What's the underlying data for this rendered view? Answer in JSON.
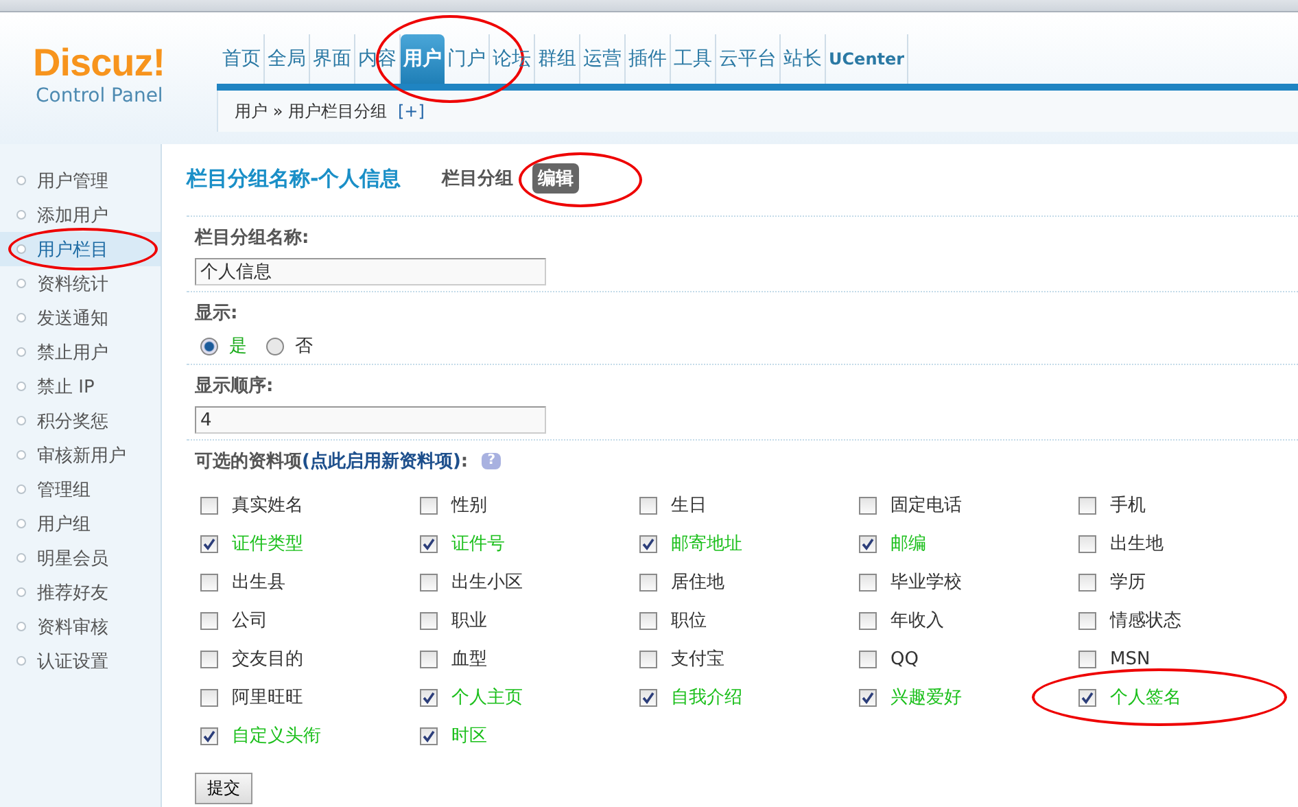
{
  "logo": {
    "title": "Discuz!",
    "subtitle": "Control Panel"
  },
  "nav": [
    {
      "label": "首页",
      "selected": false,
      "circled": false
    },
    {
      "label": "全局",
      "selected": false,
      "circled": false
    },
    {
      "label": "界面",
      "selected": false,
      "circled": false
    },
    {
      "label": "内容",
      "selected": false,
      "circled": false
    },
    {
      "label": "用户",
      "selected": true,
      "circled": true
    },
    {
      "label": "门户",
      "selected": false,
      "circled": false
    },
    {
      "label": "论坛",
      "selected": false,
      "circled": false
    },
    {
      "label": "群组",
      "selected": false,
      "circled": false
    },
    {
      "label": "运营",
      "selected": false,
      "circled": false
    },
    {
      "label": "插件",
      "selected": false,
      "circled": false
    },
    {
      "label": "工具",
      "selected": false,
      "circled": false
    },
    {
      "label": "云平台",
      "selected": false,
      "circled": false
    },
    {
      "label": "站长",
      "selected": false,
      "circled": false
    },
    {
      "label": "UCenter",
      "selected": false,
      "circled": false
    }
  ],
  "breadcrumb": {
    "path": "用户 » 用户栏目分组",
    "add": "[+]"
  },
  "sidebar": [
    {
      "label": "用户管理",
      "selected": false,
      "circled": false
    },
    {
      "label": "添加用户",
      "selected": false,
      "circled": false
    },
    {
      "label": "用户栏目",
      "selected": true,
      "circled": true
    },
    {
      "label": "资料统计",
      "selected": false,
      "circled": false
    },
    {
      "label": "发送通知",
      "selected": false,
      "circled": false
    },
    {
      "label": "禁止用户",
      "selected": false,
      "circled": false
    },
    {
      "label": "禁止 IP",
      "selected": false,
      "circled": false
    },
    {
      "label": "积分奖惩",
      "selected": false,
      "circled": false
    },
    {
      "label": "审核新用户",
      "selected": false,
      "circled": false
    },
    {
      "label": "管理组",
      "selected": false,
      "circled": false
    },
    {
      "label": "用户组",
      "selected": false,
      "circled": false
    },
    {
      "label": "明星会员",
      "selected": false,
      "circled": false
    },
    {
      "label": "推荐好友",
      "selected": false,
      "circled": false
    },
    {
      "label": "资料审核",
      "selected": false,
      "circled": false
    },
    {
      "label": "认证设置",
      "selected": false,
      "circled": false
    }
  ],
  "page_title": "栏目分组名称-个人信息",
  "tabs": [
    {
      "label": "栏目分组",
      "selected": false,
      "circled": false
    },
    {
      "label": "编辑",
      "selected": true,
      "circled": true
    }
  ],
  "form": {
    "name_label": "栏目分组名称:",
    "name_value": "个人信息",
    "display_label": "显示:",
    "display_options": [
      {
        "label": "是",
        "selected": true
      },
      {
        "label": "否",
        "selected": false
      }
    ],
    "order_label": "显示顺序:",
    "order_value": "4",
    "fields_label": "可选的资料项",
    "fields_link": "(点此启用新资料项)",
    "fields_label_end": ":",
    "help_icon": "?",
    "options": [
      {
        "label": "真实姓名",
        "checked": false,
        "circled": false
      },
      {
        "label": "性别",
        "checked": false,
        "circled": false
      },
      {
        "label": "生日",
        "checked": false,
        "circled": false
      },
      {
        "label": "固定电话",
        "checked": false,
        "circled": false
      },
      {
        "label": "手机",
        "checked": false,
        "circled": false
      },
      {
        "label": "证件类型",
        "checked": true,
        "circled": false
      },
      {
        "label": "证件号",
        "checked": true,
        "circled": false
      },
      {
        "label": "邮寄地址",
        "checked": true,
        "circled": false
      },
      {
        "label": "邮编",
        "checked": true,
        "circled": false
      },
      {
        "label": "出生地",
        "checked": false,
        "circled": false
      },
      {
        "label": "出生县",
        "checked": false,
        "circled": false
      },
      {
        "label": "出生小区",
        "checked": false,
        "circled": false
      },
      {
        "label": "居住地",
        "checked": false,
        "circled": false
      },
      {
        "label": "毕业学校",
        "checked": false,
        "circled": false
      },
      {
        "label": "学历",
        "checked": false,
        "circled": false
      },
      {
        "label": "公司",
        "checked": false,
        "circled": false
      },
      {
        "label": "职业",
        "checked": false,
        "circled": false
      },
      {
        "label": "职位",
        "checked": false,
        "circled": false
      },
      {
        "label": "年收入",
        "checked": false,
        "circled": false
      },
      {
        "label": "情感状态",
        "checked": false,
        "circled": false
      },
      {
        "label": "交友目的",
        "checked": false,
        "circled": false
      },
      {
        "label": "血型",
        "checked": false,
        "circled": false
      },
      {
        "label": "支付宝",
        "checked": false,
        "circled": false
      },
      {
        "label": "QQ",
        "checked": false,
        "circled": false
      },
      {
        "label": "MSN",
        "checked": false,
        "circled": false
      },
      {
        "label": "阿里旺旺",
        "checked": false,
        "circled": false
      },
      {
        "label": "个人主页",
        "checked": true,
        "circled": false
      },
      {
        "label": "自我介绍",
        "checked": true,
        "circled": false
      },
      {
        "label": "兴趣爱好",
        "checked": true,
        "circled": false
      },
      {
        "label": "个人签名",
        "checked": true,
        "circled": true
      },
      {
        "label": "自定义头衔",
        "checked": true,
        "circled": false
      },
      {
        "label": "时区",
        "checked": true,
        "circled": false
      }
    ],
    "submit": "提交"
  }
}
